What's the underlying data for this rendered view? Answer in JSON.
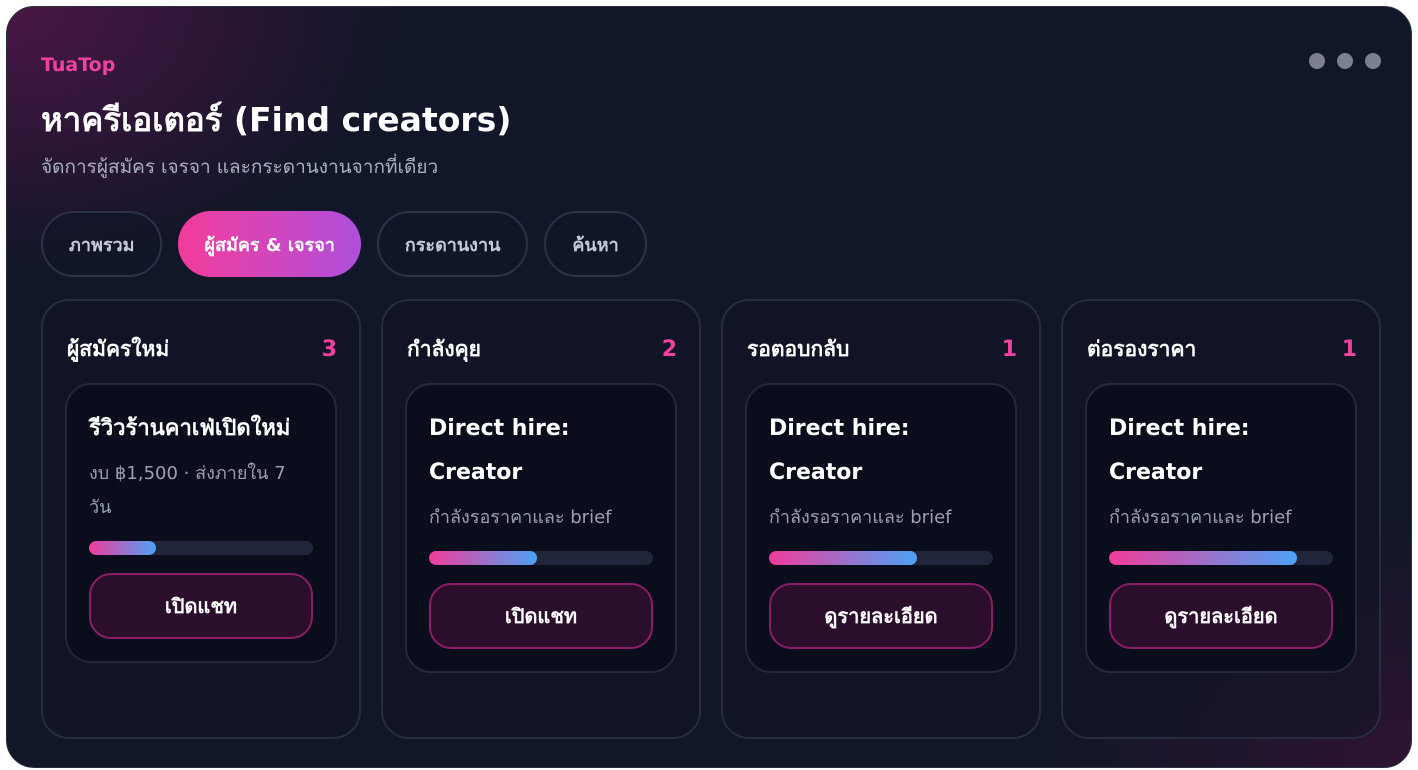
{
  "app": {
    "brand": "TuaTop",
    "title": "หาครีเอเตอร์ (Find creators)",
    "subtitle": "จัดการผู้สมัคร เจรจา และกระดานงานจากที่เดียว"
  },
  "window_controls": [
    "more-dot",
    "more-dot",
    "more-dot"
  ],
  "tabs": [
    {
      "label": "ภาพรวม",
      "active": false
    },
    {
      "label": "ผู้สมัคร & เจรจา",
      "active": true
    },
    {
      "label": "กระดานงาน",
      "active": false
    },
    {
      "label": "ค้นหา",
      "active": false
    }
  ],
  "columns": [
    {
      "title": "ผู้สมัครใหม่",
      "count": "3",
      "card": {
        "title": "รีวิวร้านคาเฟ่เปิดใหม่",
        "subtitle": "งบ ฿1,500 · ส่งภายใน 7 วัน",
        "progress": 0.3,
        "button": "เปิดแชท"
      }
    },
    {
      "title": "กำลังคุย",
      "count": "2",
      "card": {
        "title": "Direct hire: Creator",
        "subtitle": "กำลังรอราคาและ brief",
        "progress": 0.48,
        "button": "เปิดแชท"
      }
    },
    {
      "title": "รอตอบกลับ",
      "count": "1",
      "card": {
        "title": "Direct hire: Creator",
        "subtitle": "กำลังรอราคาและ brief",
        "progress": 0.66,
        "button": "ดูรายละเอียด"
      }
    },
    {
      "title": "ต่อรองราคา",
      "count": "1",
      "card": {
        "title": "Direct hire: Creator",
        "subtitle": "กำลังรอราคาและ brief",
        "progress": 0.84,
        "button": "ดูรายละเอียด"
      }
    }
  ],
  "colors": {
    "accent": "#f0419e",
    "tab_gradient_start": "#f23c9b",
    "tab_gradient_end": "#b04fdc",
    "progress_start": "#f23c9b",
    "progress_end": "#4da2f5",
    "background": "#111628"
  }
}
